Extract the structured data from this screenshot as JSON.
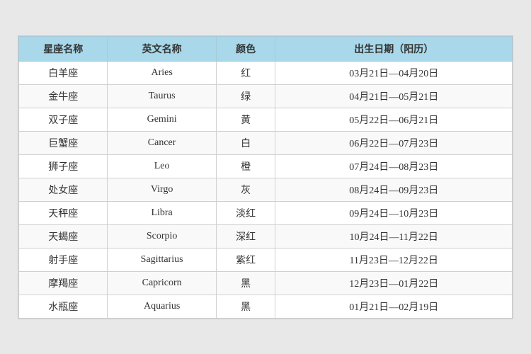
{
  "table": {
    "headers": {
      "zh_name": "星座名称",
      "en_name": "英文名称",
      "color": "颜色",
      "date": "出生日期（阳历）"
    },
    "rows": [
      {
        "zh": "白羊座",
        "en": "Aries",
        "color": "红",
        "date": "03月21日—04月20日"
      },
      {
        "zh": "金牛座",
        "en": "Taurus",
        "color": "绿",
        "date": "04月21日—05月21日"
      },
      {
        "zh": "双子座",
        "en": "Gemini",
        "color": "黄",
        "date": "05月22日—06月21日"
      },
      {
        "zh": "巨蟹座",
        "en": "Cancer",
        "color": "白",
        "date": "06月22日—07月23日"
      },
      {
        "zh": "狮子座",
        "en": "Leo",
        "color": "橙",
        "date": "07月24日—08月23日"
      },
      {
        "zh": "处女座",
        "en": "Virgo",
        "color": "灰",
        "date": "08月24日—09月23日"
      },
      {
        "zh": "天秤座",
        "en": "Libra",
        "color": "淡红",
        "date": "09月24日—10月23日"
      },
      {
        "zh": "天蝎座",
        "en": "Scorpio",
        "color": "深红",
        "date": "10月24日—11月22日"
      },
      {
        "zh": "射手座",
        "en": "Sagittarius",
        "color": "紫红",
        "date": "11月23日—12月22日"
      },
      {
        "zh": "摩羯座",
        "en": "Capricorn",
        "color": "黑",
        "date": "12月23日—01月22日"
      },
      {
        "zh": "水瓶座",
        "en": "Aquarius",
        "color": "黑",
        "date": "01月21日—02月19日"
      }
    ]
  }
}
